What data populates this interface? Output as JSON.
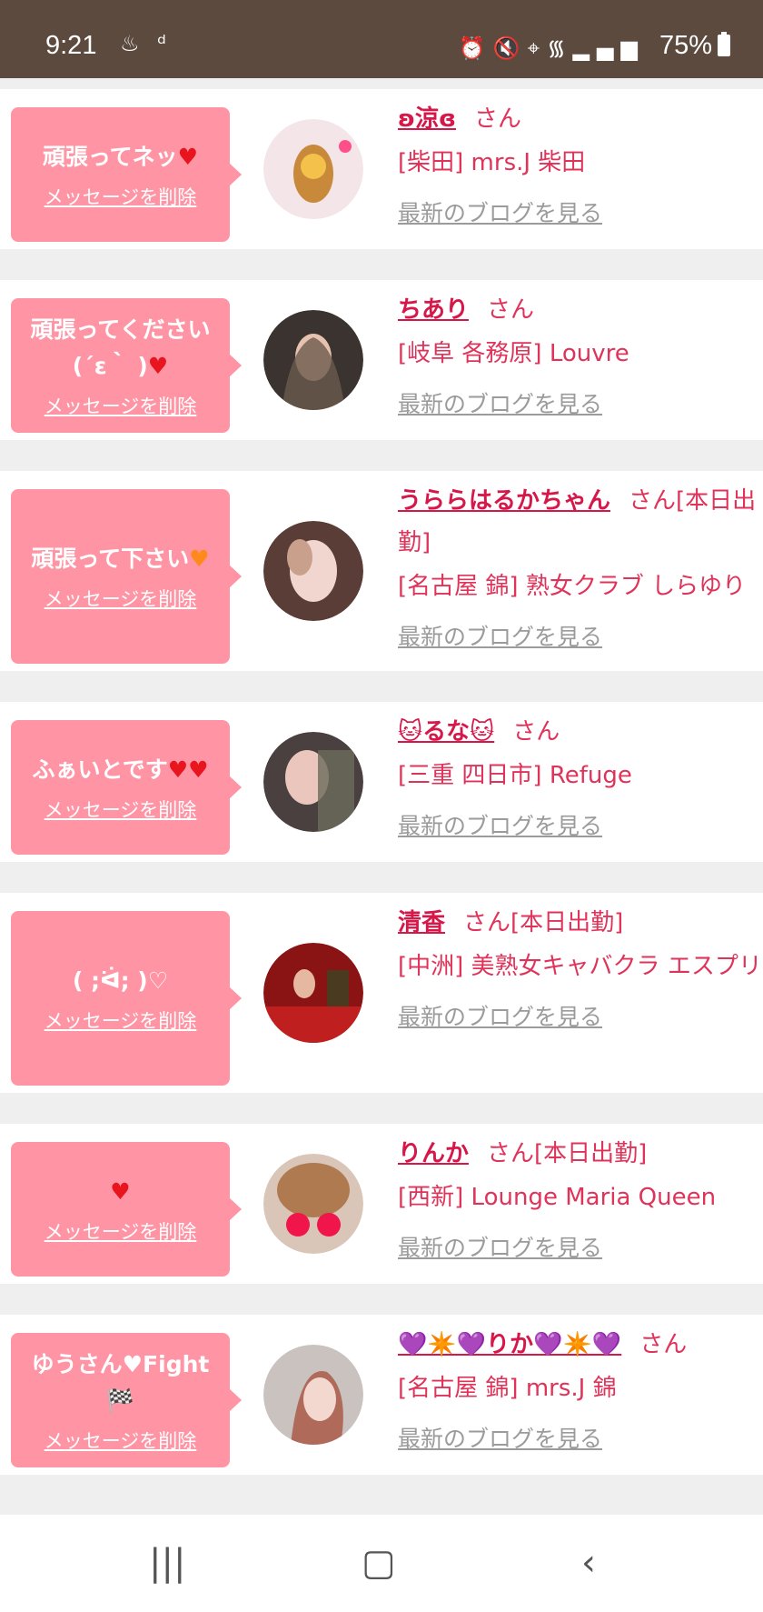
{
  "status": {
    "time": "9:21",
    "battery": "75%"
  },
  "items": [
    {
      "message": "頑張ってネッ",
      "heart": "♥",
      "delete": "メッセージを削除",
      "name": "ʚ涼ɞ",
      "san": "さん",
      "shop": "[柴田] mrs.J 柴田",
      "blog": "最新のブログを見る"
    },
    {
      "message": "頑張ってください(´ε｀ )",
      "heart": "♥",
      "delete": "メッセージを削除",
      "name": "ちあり",
      "san": "さん",
      "shop": "[岐阜 各務原] Louvre",
      "blog": "最新のブログを見る"
    },
    {
      "message": "頑張って下さい",
      "heart": "♥",
      "delete": "メッセージを削除",
      "name": "うららはるかちゃん",
      "san": "さん[本日出勤]",
      "shop": "[名古屋 錦] 熟女クラブ しらゆり",
      "blog": "最新のブログを見る"
    },
    {
      "message": "ふぁいとです",
      "heart": "♥♥",
      "delete": "メッセージを削除",
      "name": "🐱るな🐱",
      "san": "さん",
      "shop": "[三重 四日市] Refuge",
      "blog": "最新のブログを見る"
    },
    {
      "message": "( ;ᐛ; )♡",
      "heart": "",
      "delete": "メッセージを削除",
      "name": "清香",
      "san": "さん[本日出勤]",
      "shop": "[中洲] 美熟女キャバクラ エスプリ",
      "blog": "最新のブログを見る"
    },
    {
      "message": "",
      "heart": "♥",
      "delete": "メッセージを削除",
      "name": "りんか",
      "san": "さん[本日出勤]",
      "shop": "[西新] Lounge Maria Queen",
      "blog": "最新のブログを見る"
    },
    {
      "message": "ゆうさん♥Fight 🏁",
      "heart": "",
      "delete": "メッセージを削除",
      "name": "💜✴️💜りか💜✴️💜",
      "san": "さん",
      "shop": "[名古屋 錦] mrs.J 錦",
      "blog": "最新のブログを見る"
    }
  ],
  "colors": {
    "bubble": "#ff95a4",
    "accent": "#d6174a",
    "statusbar": "#5c4a3e"
  }
}
